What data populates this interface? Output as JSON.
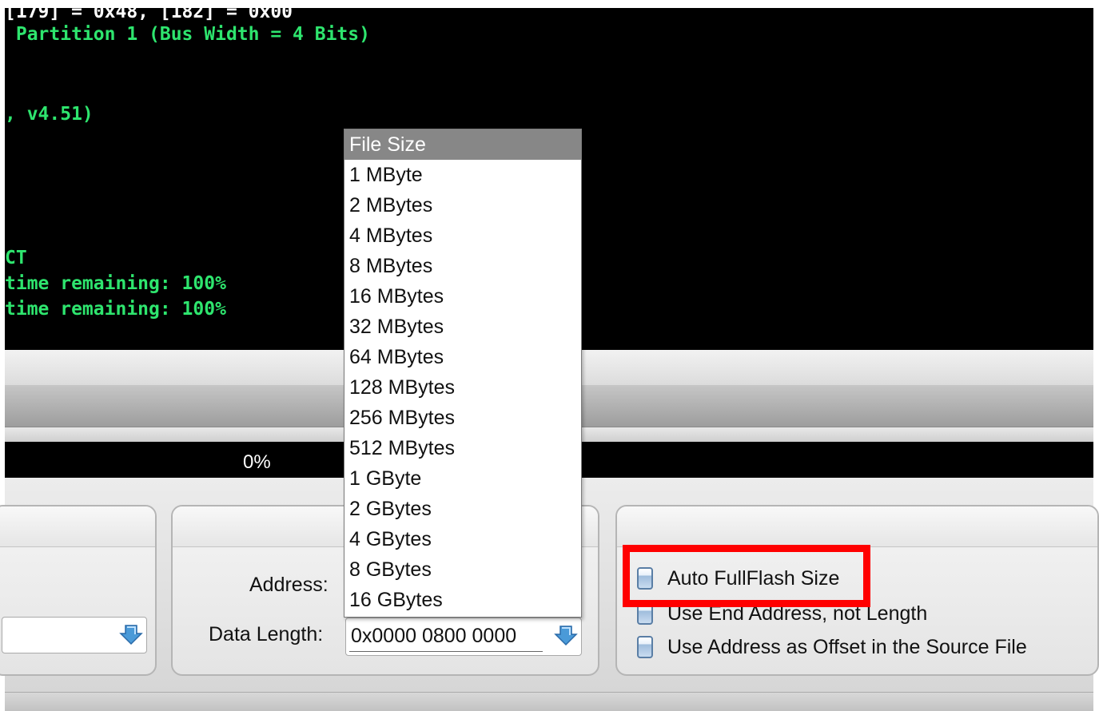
{
  "console": {
    "lines": [
      {
        "text": "[179] = 0x48, [182] = 0x00",
        "color": "#ffffff"
      },
      {
        "text": " Partition 1 (Bus Width = 4 Bits)",
        "color": "#2ee56e"
      },
      {
        "text": ", v4.51)",
        "color": "#2ee56e"
      },
      {
        "text": "CT",
        "color": "#2ee56e"
      },
      {
        "text": "time remaining: 100%",
        "color": "#2ee56e"
      },
      {
        "text": "time remaining: 100%",
        "color": "#2ee56e"
      }
    ]
  },
  "progress": {
    "text": "0%"
  },
  "fields": {
    "address_label": "Address:",
    "data_length_label": "Data Length:",
    "data_length_value": "0x0000 0800 0000"
  },
  "options": {
    "auto_fullflash": "Auto FullFlash Size",
    "use_end_address": "Use End Address, not Length",
    "use_offset": "Use Address as Offset in the Source File"
  },
  "dropdown": {
    "selected_index": 0,
    "items": [
      "File Size",
      "1 MByte",
      "2 MBytes",
      "4 MBytes",
      "8 MBytes",
      "16 MBytes",
      "32 MBytes",
      "64 MBytes",
      "128 MBytes",
      "256 MBytes",
      "512 MBytes",
      "1 GByte",
      "2 GBytes",
      "4 GBytes",
      "8 GBytes",
      "16 GBytes"
    ]
  },
  "colors": {
    "highlight": "#ff0000",
    "console_text": "#2ee56e",
    "selected_item": "#878787"
  },
  "icons": {
    "combo_arrow": "down-arrow-icon"
  }
}
